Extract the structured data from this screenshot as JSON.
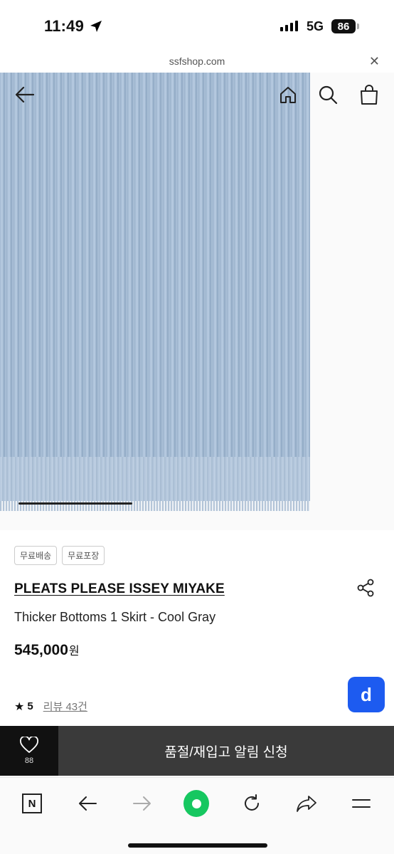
{
  "status_bar": {
    "time": "11:49",
    "network": "5G",
    "battery": "86"
  },
  "browser": {
    "url": "ssfshop.com"
  },
  "badges": [
    "무료배송",
    "무료포장"
  ],
  "product": {
    "brand": "PLEATS PLEASE ISSEY MIYAKE",
    "name": "Thicker Bottoms 1 Skirt - Cool Gray",
    "price": "545,000",
    "price_unit": "원",
    "rating": "5",
    "review_link": "리뷰 43건"
  },
  "fab_label": "d",
  "action_bar": {
    "wish_count": "88",
    "cta_label": "품절/재입고 알림 신청"
  },
  "toolbar": {
    "n_label": "N"
  },
  "colors": {
    "accent_blue": "#1d5bf0",
    "green": "#16c760",
    "cta_bg": "#3a3a3a",
    "wish_bg": "#111111"
  },
  "icons": [
    "location-arrow-icon",
    "signal-icon",
    "battery-icon",
    "close-icon",
    "back-arrow-icon",
    "home-icon",
    "search-icon",
    "shopping-bag-icon",
    "share-icon",
    "star-icon",
    "heart-icon",
    "back-icon",
    "forward-icon",
    "refresh-icon",
    "share-arrow-icon",
    "menu-icon"
  ]
}
